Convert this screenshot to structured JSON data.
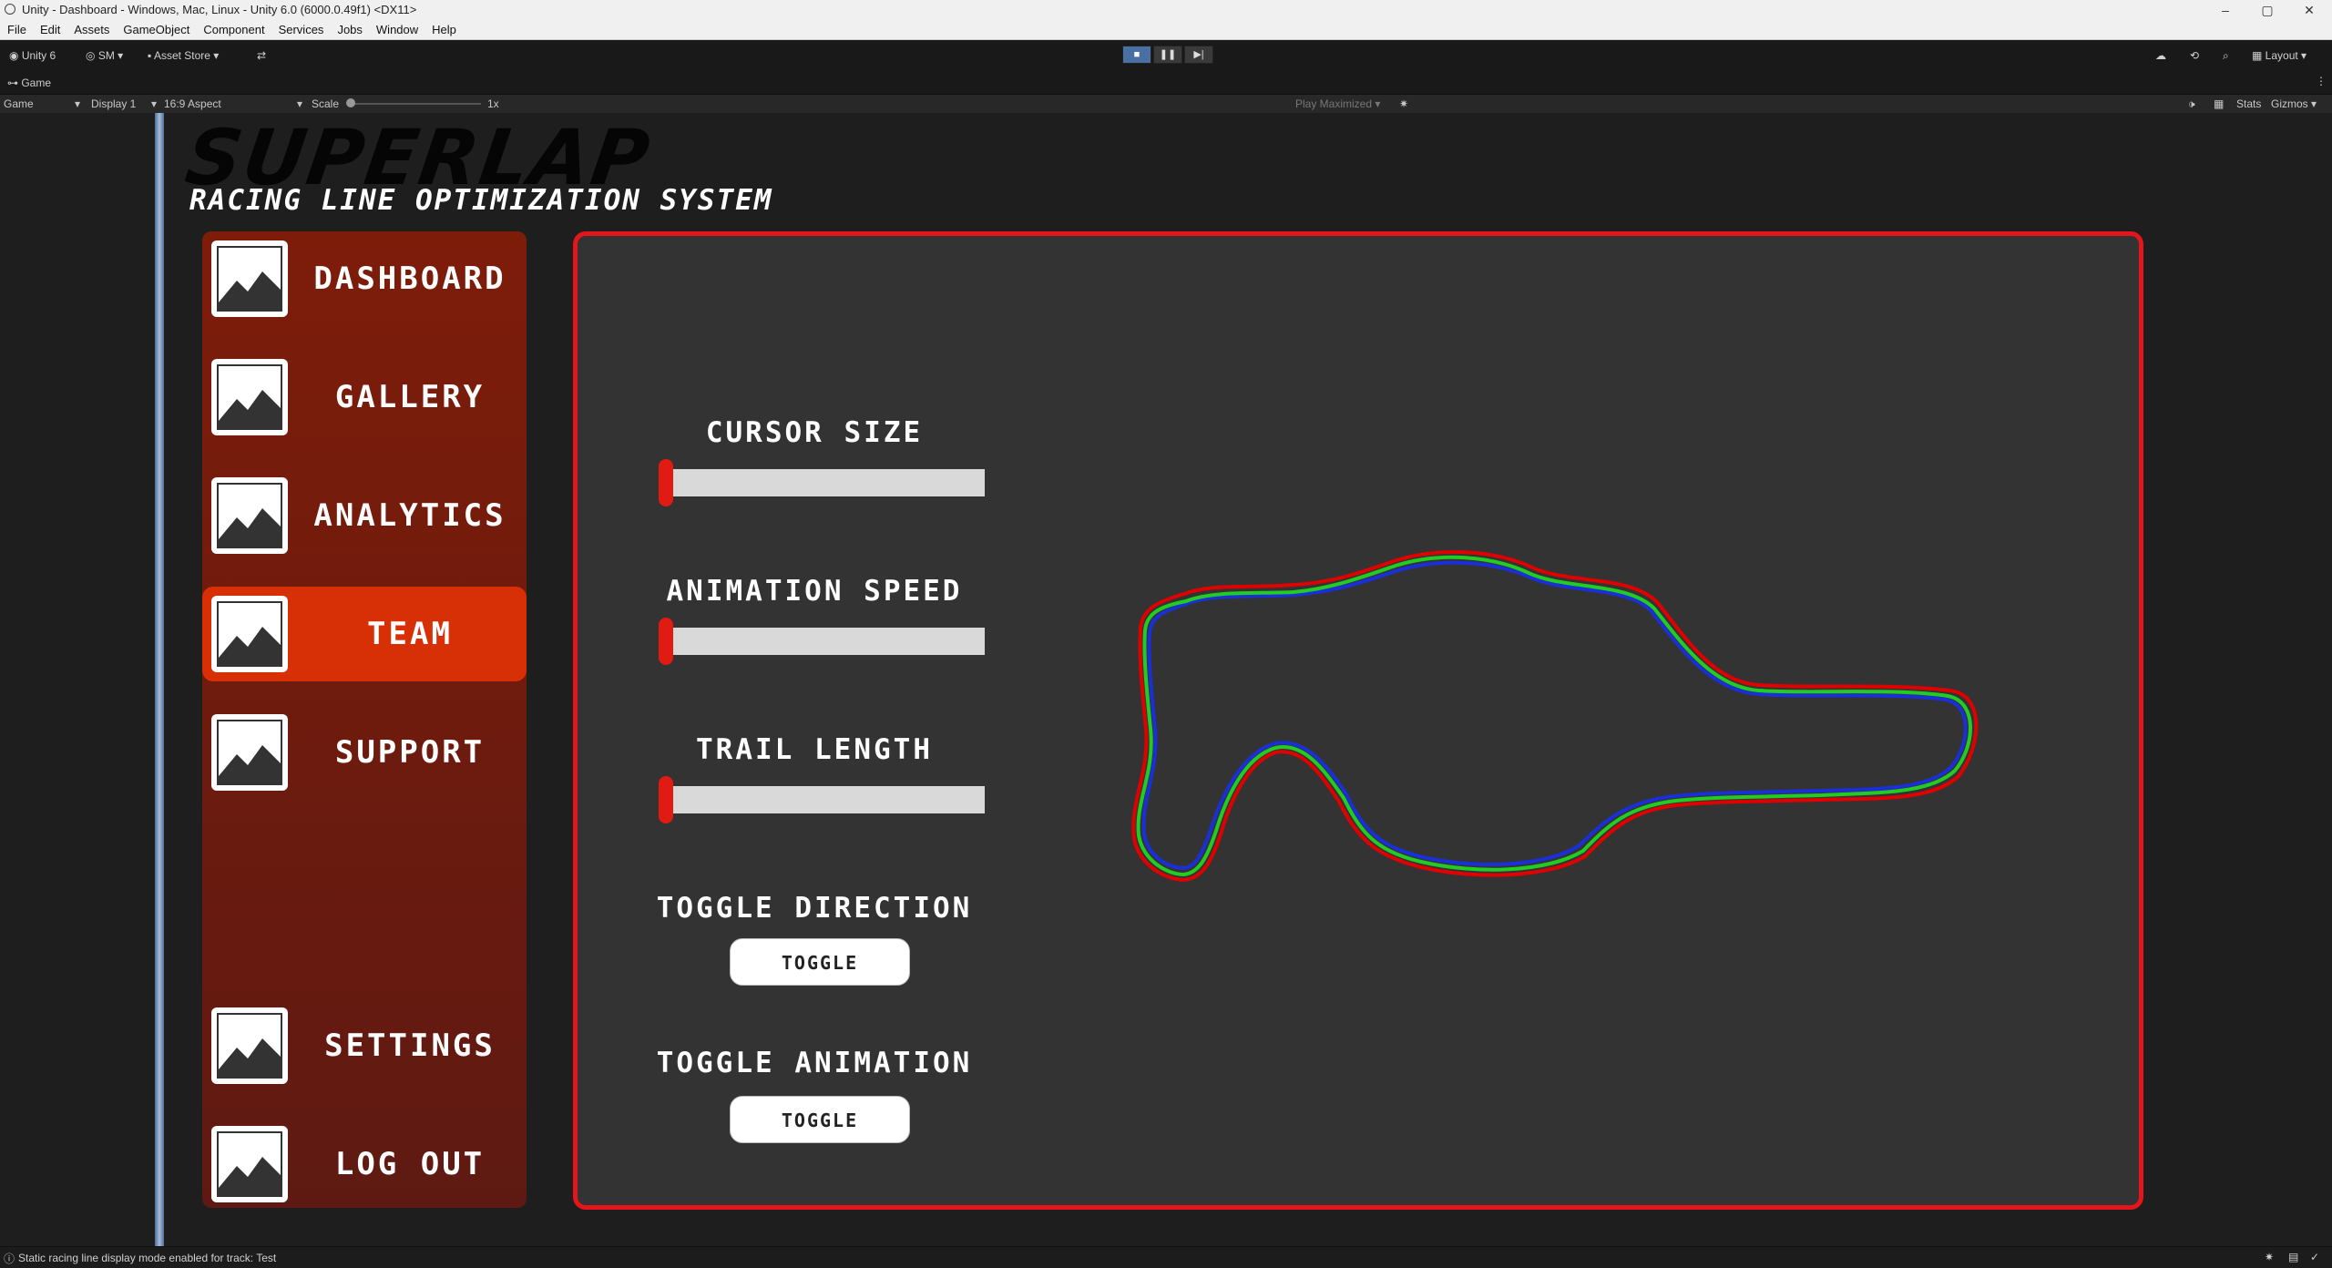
{
  "window": {
    "title": "Unity - Dashboard - Windows, Mac, Linux - Unity 6.0 (6000.0.49f1) <DX11>",
    "controls": [
      "–",
      "▢",
      "✕"
    ]
  },
  "menu": [
    "File",
    "Edit",
    "Assets",
    "GameObject",
    "Component",
    "Services",
    "Jobs",
    "Window",
    "Help"
  ],
  "toolbar": {
    "unity_label": "Unity 6",
    "account": "SM",
    "asset_store": "Asset Store",
    "layout": "Layout"
  },
  "game_tab": {
    "label": "Game"
  },
  "game_controls": {
    "mode": "Game",
    "display": "Display 1",
    "aspect": "16:9 Aspect",
    "scale_label": "Scale",
    "scale_value": "1x",
    "play_mode": "Play Maximized",
    "stats": "Stats",
    "gizmos": "Gizmos"
  },
  "logo": {
    "main": "SUPERLAP",
    "sub": "RACING LINE OPTIMIZATION SYSTEM"
  },
  "nav": {
    "items": [
      {
        "label": "DASHBOARD"
      },
      {
        "label": "GALLERY"
      },
      {
        "label": "ANALYTICS"
      },
      {
        "label": "TEAM"
      },
      {
        "label": "SUPPORT"
      },
      {
        "label": "SETTINGS"
      },
      {
        "label": "LOG OUT"
      }
    ],
    "active": "TEAM"
  },
  "controls": {
    "cursor_size": {
      "label": "CURSOR SIZE",
      "value": 0
    },
    "animation_speed": {
      "label": "ANIMATION SPEED",
      "value": 0
    },
    "trail_length": {
      "label": "TRAIL LENGTH",
      "value": 0
    },
    "toggle_direction": {
      "label": "TOGGLE DIRECTION",
      "button": "TOGGLE"
    },
    "toggle_animation": {
      "label": "TOGGLE ANIMATION",
      "button": "TOGGLE"
    }
  },
  "colors": {
    "accent_red": "#e4151b",
    "nav_active": "#d73006",
    "sidebar": "#7e1c0a",
    "track_outer": "#e00000",
    "track_blue": "#1a2fd8",
    "track_green": "#22cc22"
  },
  "status": {
    "message": "Static racing line display mode enabled for track: Test"
  }
}
